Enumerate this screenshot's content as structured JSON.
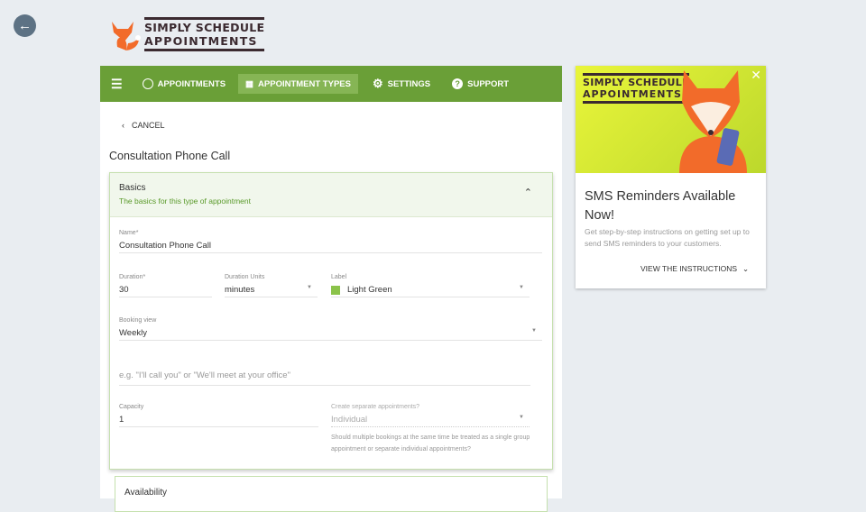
{
  "back": {
    "icon": "arrow-left-icon"
  },
  "logo": {
    "line1": "SIMPLY SCHEDULE",
    "line2": "APPOINTMENTS"
  },
  "nav": {
    "items": [
      {
        "label": "APPOINTMENTS",
        "icon": "clock-icon"
      },
      {
        "label": "APPOINTMENT TYPES",
        "icon": "list-icon",
        "active": true
      },
      {
        "label": "SETTINGS",
        "icon": "gear-icon"
      },
      {
        "label": "SUPPORT",
        "icon": "help-icon"
      }
    ]
  },
  "cancel": "CANCEL",
  "page_title": "Consultation Phone Call",
  "basics": {
    "title": "Basics",
    "subtitle": "The basics for this type of appointment"
  },
  "form": {
    "name": {
      "label": "Name",
      "value": "Consultation Phone Call"
    },
    "duration": {
      "label": "Duration",
      "value": "30"
    },
    "duration_units": {
      "label": "Duration Units",
      "value": "minutes"
    },
    "label": {
      "label": "Label",
      "value": "Light Green",
      "color": "#8bc34a"
    },
    "booking_view": {
      "label": "Booking view",
      "value": "Weekly"
    },
    "location": {
      "placeholder": "e.g. \"I'll call you\" or \"We'll meet at your office\""
    },
    "capacity": {
      "label": "Capacity",
      "value": "1"
    },
    "separate": {
      "label": "Create separate appointments?",
      "value": "Individual",
      "help": "Should multiple bookings at the same time be treated as a single group appointment or separate individual appointments?"
    }
  },
  "availability": {
    "title": "Availability"
  },
  "promo": {
    "logo1": "SIMPLY SCHEDULE",
    "logo2": "APPOINTMENTS",
    "title": "SMS Reminders Available Now!",
    "description": "Get step-by-step instructions on getting set up to send SMS reminders to your customers.",
    "button": "VIEW THE INSTRUCTIONS"
  }
}
